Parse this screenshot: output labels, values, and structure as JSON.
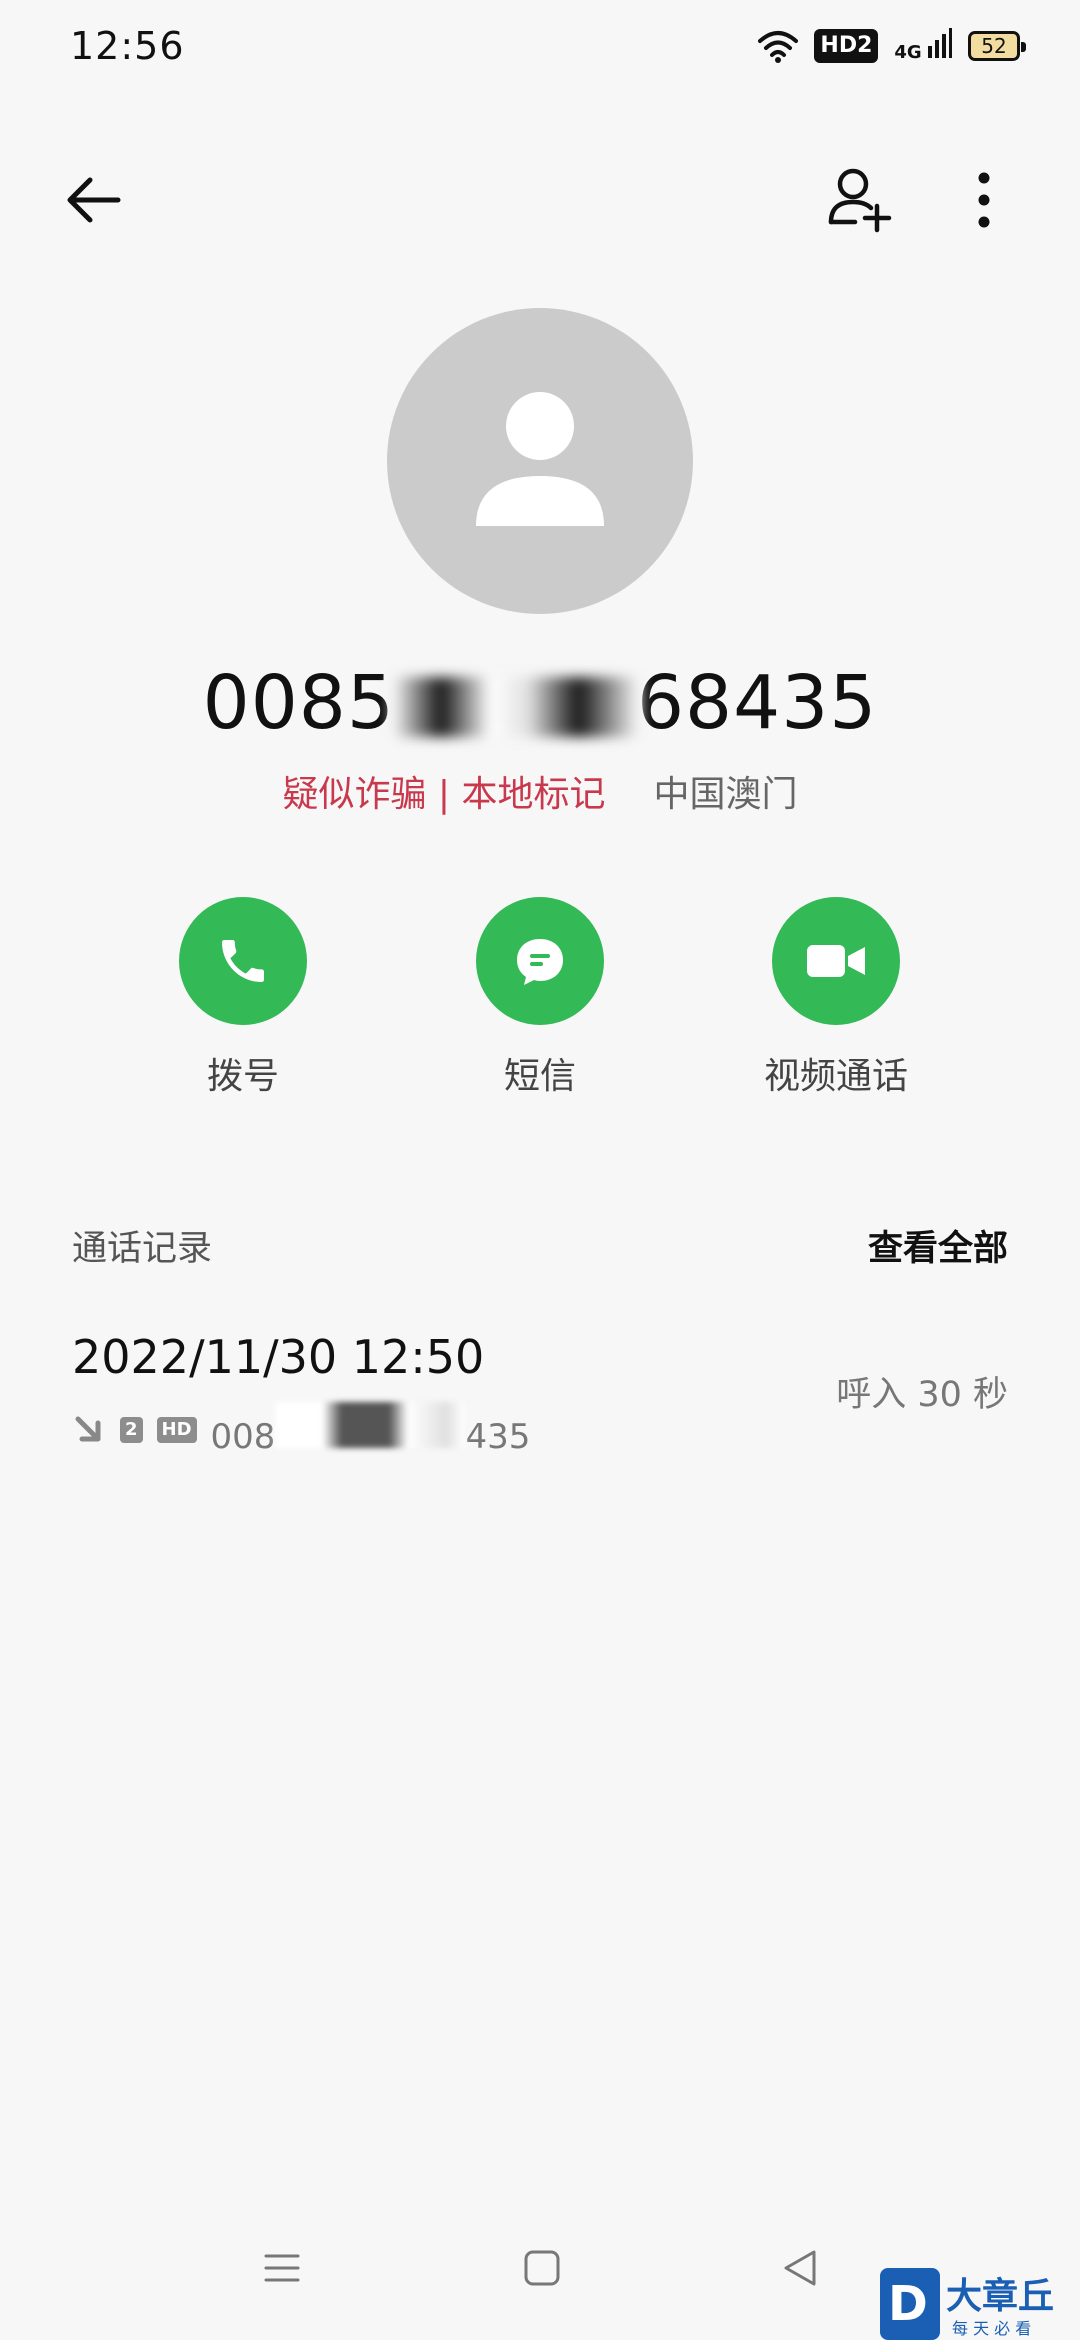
{
  "status_bar": {
    "time": "12:56",
    "hd_badge": "HD2",
    "network": "4G",
    "battery": "52"
  },
  "contact": {
    "number_prefix": "0085",
    "number_suffix": "68435",
    "tag_suspect": "疑似诈骗 | 本地标记",
    "region": "中国澳门"
  },
  "actions": {
    "call_label": "拨号",
    "sms_label": "短信",
    "video_label": "视频通话"
  },
  "history": {
    "title": "通话记录",
    "view_all": "查看全部",
    "records": [
      {
        "datetime": "2022/11/30 12:50",
        "sim": "2",
        "hd": "HD",
        "number_prefix": "008",
        "number_suffix": "435",
        "summary": "呼入  30 秒"
      }
    ]
  },
  "watermark": {
    "brand": "大章丘",
    "tagline": "每 天 必 看"
  },
  "colors": {
    "accent_green": "#33b956",
    "warning_red": "#c9394d",
    "avatar_gray": "#cbcbcb"
  }
}
